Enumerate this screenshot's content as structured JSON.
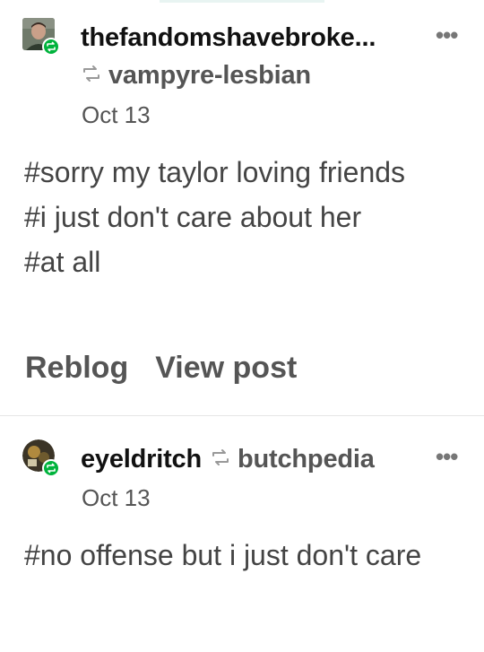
{
  "colors": {
    "reblog_badge": "#00b33c",
    "username": "#111111",
    "secondary_text": "#555555",
    "tag_text": "#444444",
    "divider": "#e6e6e6"
  },
  "posts": [
    {
      "avatar_icon": "user-avatar",
      "username": "thefandomshavebroke...",
      "reblog_icon": "reblog-icon",
      "reblogged_from": "vampyre-lesbian",
      "date": "Oct 13",
      "more_icon": "ellipsis-icon",
      "more_label": "•••",
      "tags": [
        "#sorry my taylor loving friends",
        "#i just don't care about her",
        "#at all"
      ],
      "actions": {
        "reblog": "Reblog",
        "view_post": "View post"
      }
    },
    {
      "avatar_icon": "user-avatar",
      "username": "eyeldritch",
      "reblog_icon": "reblog-icon",
      "reblogged_from": "butchpedia",
      "date": "Oct 13",
      "more_icon": "ellipsis-icon",
      "more_label": "•••",
      "tags": [
        "#no offense but i just don't care"
      ]
    }
  ]
}
